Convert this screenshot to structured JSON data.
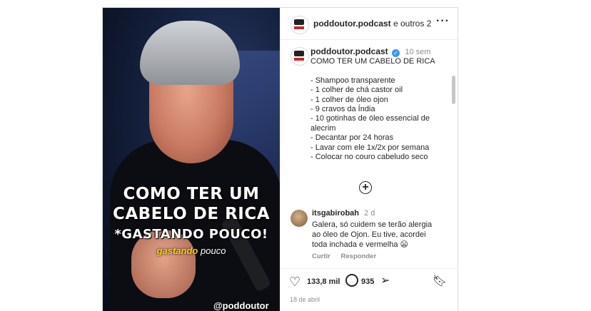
{
  "media": {
    "caption_line1": "COMO TER UM",
    "caption_line2": "CABELO DE RICA",
    "caption_line3": "*GASTANDO POUCO!",
    "subtitle_highlight": "gastando",
    "subtitle_rest": "pouco",
    "watermark": "@poddoutor"
  },
  "header": {
    "username": "poddoutor.podcast",
    "collab": "e outros 2",
    "more_icon": "more-horizontal-icon"
  },
  "post": {
    "username": "poddoutor.podcast",
    "time": "10 sem",
    "text": "COMO TER UM CABELO DE RICA\n\n- Shampoo transparente\n- 1 colher de chá castor oil\n- 1 colher de óleo ojon\n- 9 cravos da Índia\n- 10 gotinhas de óleo essencial de alecrim\n- Decantar por 24 horas\n- Lavar com ele 1x/2x por semana\n- Colocar no couro cabeludo seco"
  },
  "comment": {
    "username": "itsgabirobah",
    "time": "2 d",
    "text": "Galera, só cuidem se terão alergia ao óleo de Ojon. Eu tive, acordei toda inchada e vermelha 😦",
    "like_label": "Curtir",
    "reply_label": "Responder"
  },
  "actions": {
    "likes": "133,8 mil",
    "comments": "935",
    "date": "18 de abril"
  },
  "colors": {
    "verified": "#3897f0",
    "subtitle_highlight": "#f5d20a",
    "muted_text": "#8e8e8e"
  }
}
